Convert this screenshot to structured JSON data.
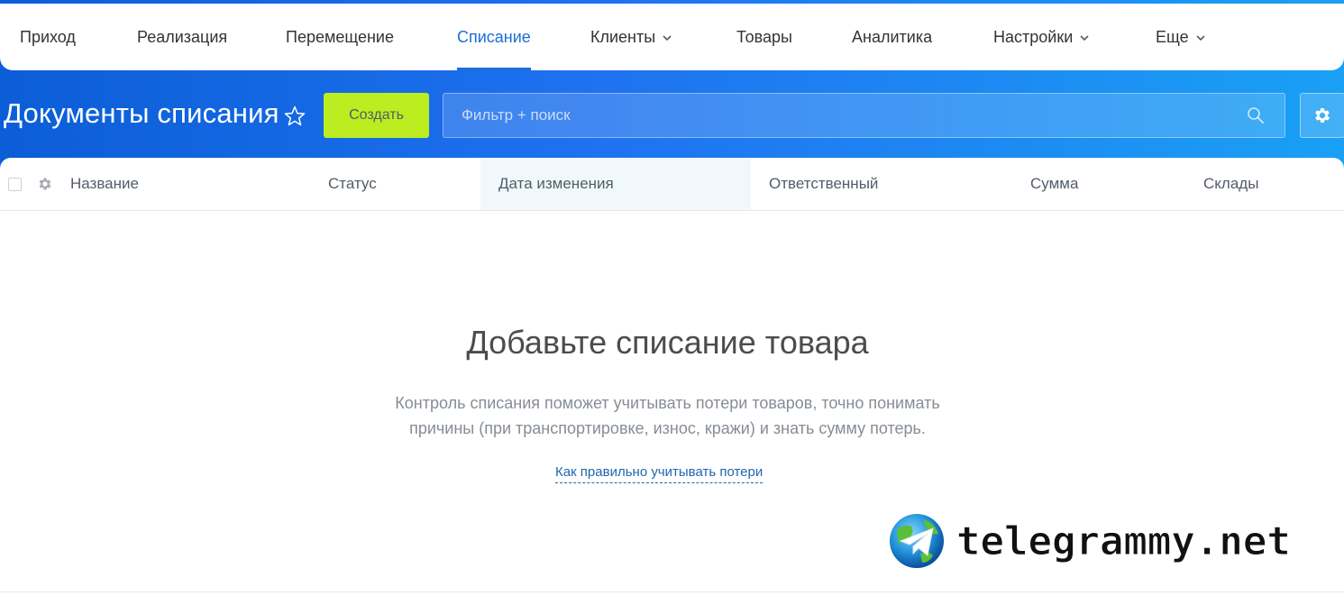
{
  "nav": {
    "items": [
      {
        "label": "Приход",
        "dropdown": false,
        "active": false
      },
      {
        "label": "Реализация",
        "dropdown": false,
        "active": false
      },
      {
        "label": "Перемещение",
        "dropdown": false,
        "active": false
      },
      {
        "label": "Списание",
        "dropdown": false,
        "active": true
      },
      {
        "label": "Клиенты",
        "dropdown": true,
        "active": false
      },
      {
        "label": "Товары",
        "dropdown": false,
        "active": false
      },
      {
        "label": "Аналитика",
        "dropdown": false,
        "active": false
      },
      {
        "label": "Настройки",
        "dropdown": true,
        "active": false
      },
      {
        "label": "Еще",
        "dropdown": true,
        "active": false
      }
    ]
  },
  "header": {
    "title": "Документы списания",
    "create_label": "Создать",
    "search_placeholder": "Фильтр + поиск"
  },
  "grid": {
    "columns": [
      "Название",
      "Статус",
      "Дата изменения",
      "Ответственный",
      "Сумма",
      "Склады"
    ],
    "sorted_column": "Дата изменения"
  },
  "empty_state": {
    "title": "Добавьте списание товара",
    "description_line1": "Контроль списания поможет учитывать потери товаров, точно понимать",
    "description_line2": "причины (при транспортировке, износ, кражи) и знать сумму потерь.",
    "link": "Как правильно учитывать потери"
  },
  "watermark": {
    "text": "telegrammy.net"
  },
  "colors": {
    "accent": "#1a6fd6",
    "create_button": "#bbed21",
    "header_gradient_start": "#0b5ed7",
    "header_gradient_end": "#1aa0f5",
    "link": "#2067b0"
  }
}
